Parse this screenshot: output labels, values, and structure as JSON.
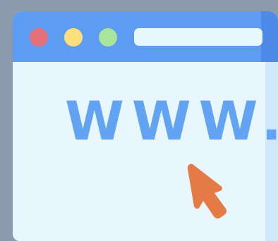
{
  "browser": {
    "window_controls": {
      "close": "red-dot",
      "minimize": "yellow-dot",
      "maximize": "green-dot"
    },
    "address_bar": {
      "value": ""
    },
    "content": {
      "url_text": "www."
    }
  },
  "icons": {
    "cursor": "pointer-arrow-icon"
  },
  "colors": {
    "background": "#8b9aaf",
    "title_bar": "#5c9cf2",
    "content": "#e7f7fd",
    "url_text": "#62a3f3",
    "cursor": "#e47b47",
    "close_dot": "#e46f79",
    "minimize_dot": "#ffe07a",
    "maximize_dot": "#a8e49b"
  }
}
